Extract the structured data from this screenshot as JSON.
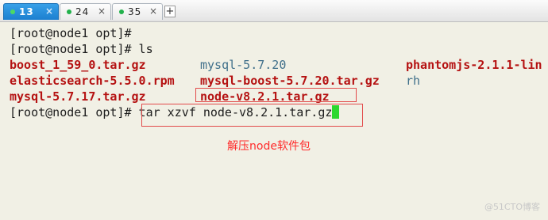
{
  "tabs": [
    {
      "label": "13",
      "close": "×"
    },
    {
      "label": "24",
      "close": "×"
    },
    {
      "label": "35",
      "close": "×"
    }
  ],
  "new_tab": "+",
  "terminal": {
    "line1": "[root@node1 opt]#",
    "line2": "[root@node1 opt]# ls",
    "ls_files": [
      [
        "boost_1_59_0.tar.gz",
        "mysql-5.7.20",
        "phantomjs-2.1.1-lin"
      ],
      [
        "elasticsearch-5.5.0.rpm",
        "mysql-boost-5.7.20.tar.gz",
        "rh"
      ],
      [
        "mysql-5.7.17.tar.gz",
        "node-v8.2.1.tar.gz",
        ""
      ]
    ],
    "prompt": "[root@node1 opt]#",
    "command": " tar xzvf node-v8.2.1.tar.gz"
  },
  "annotation": "解压node软件包",
  "watermark": "@51CTO博客",
  "colors": {
    "archive": "#b51212",
    "directory": "#3f6f8a",
    "annotation": "#ff2b2b",
    "cursor": "#2bd82f",
    "tab_active": "#1c7fd0"
  }
}
